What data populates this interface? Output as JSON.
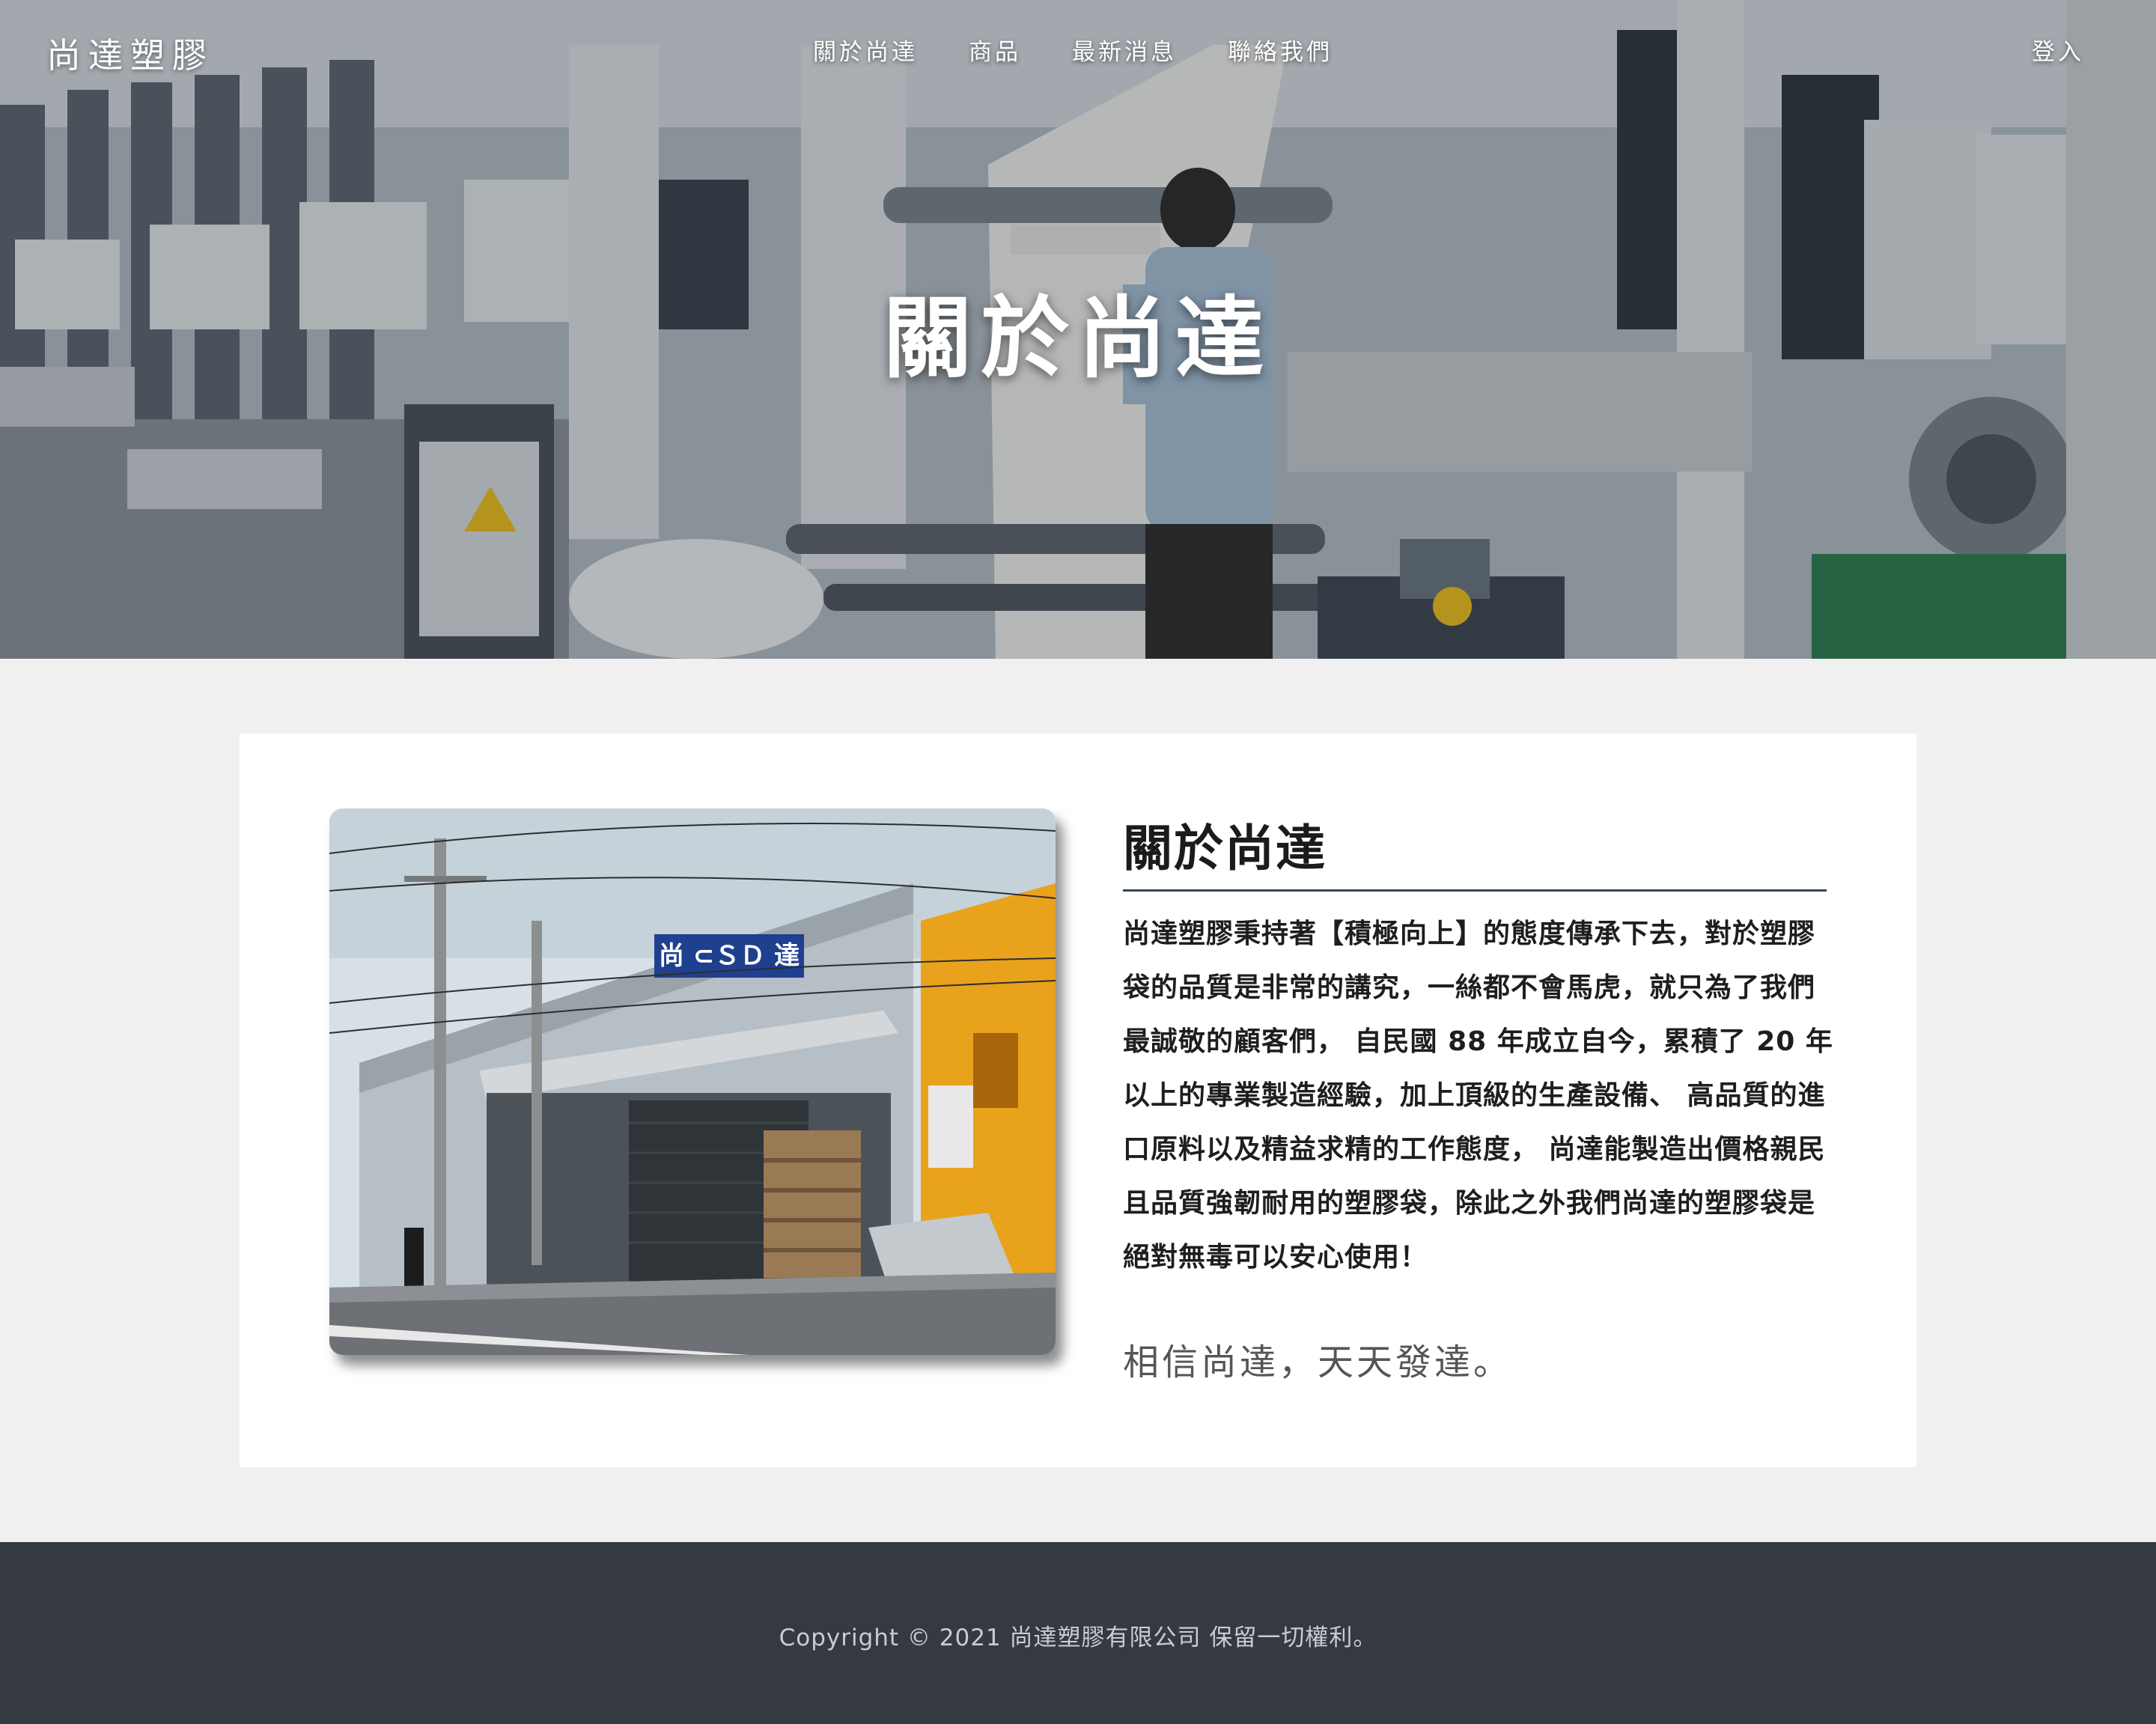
{
  "nav": {
    "brand": "尚達塑膠",
    "links": [
      "關於尚達",
      "商品",
      "最新消息",
      "聯絡我們"
    ],
    "login": "登入"
  },
  "hero": {
    "title": "關於尚達"
  },
  "about": {
    "heading": "關於尚達",
    "body": "尚達塑膠秉持著【積極向上】的態度傳承下去，對於塑膠袋的品質是非常的講究，一絲都不會馬虎，就只為了我們最誠敬的顧客們， 自民國 88 年成立自今，累積了 20 年以上的專業製造經驗，加上頂級的生產設備、 高品質的進口原料以及精益求精的工作態度， 尚達能製造出價格親民且品質強韌耐用的塑膠袋，除此之外我們尚達的塑膠袋是絕對無毒可以安心使用！",
    "slogan": "相信尚達，天天發達。",
    "photo_sign": "尚 ⊂ＳＤ 達"
  },
  "footer": {
    "copyright": "Copyright © 2021 尚達塑膠有限公司 保留一切權利。"
  },
  "colors": {
    "page_bg": "#f0f0f0",
    "card_bg": "#ffffff",
    "footer_bg": "#343a40",
    "heading_rule": "#34465a",
    "sign_blue": "#1f3f8f",
    "yellow_building": "#e9a21c"
  }
}
